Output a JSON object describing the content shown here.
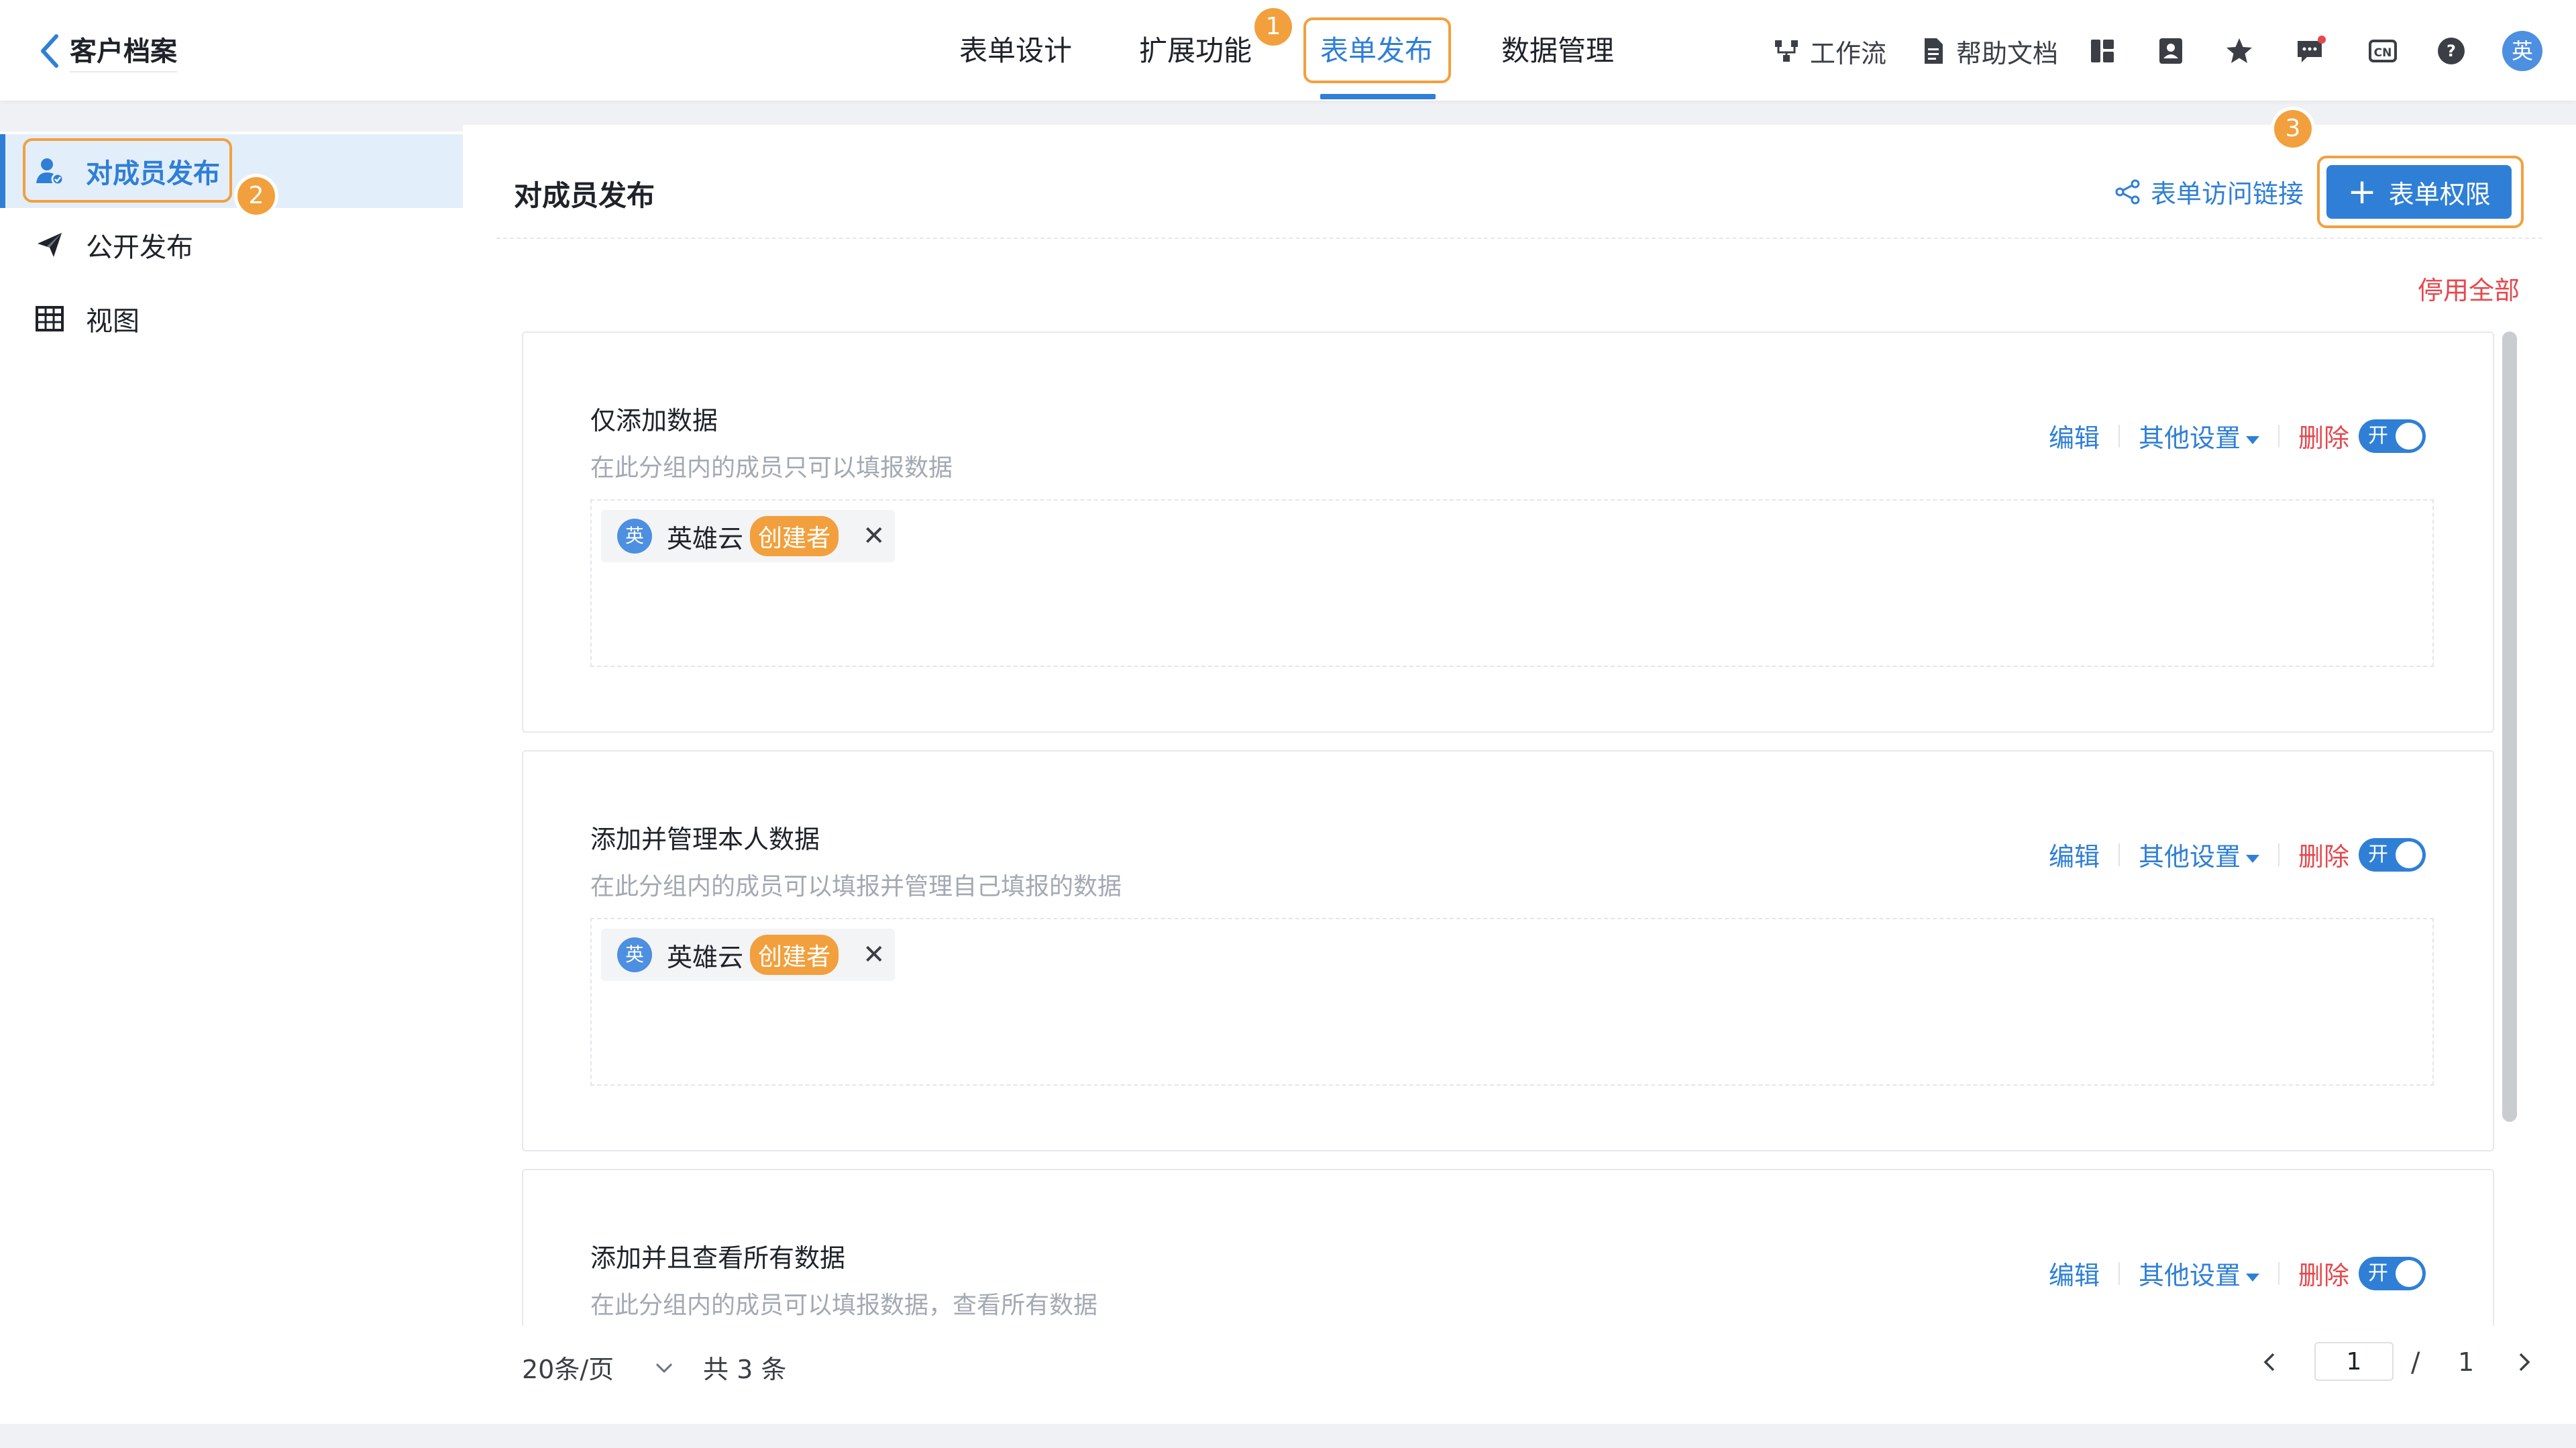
{
  "header": {
    "back_title": "客户档案",
    "tabs": [
      {
        "label": "表单设计"
      },
      {
        "label": "扩展功能"
      },
      {
        "label": "表单发布"
      },
      {
        "label": "数据管理"
      }
    ],
    "tools": {
      "workflow": "工作流",
      "help_docs": "帮助文档"
    },
    "user_avatar": "英",
    "badges": [
      "1",
      "2",
      "3"
    ],
    "colors": {
      "accent": "#2f7fd6",
      "highlight": "#f2a03d",
      "danger": "#e5484d"
    }
  },
  "sidebar": {
    "items": [
      {
        "label": "对成员发布"
      },
      {
        "label": "公开发布"
      },
      {
        "label": "视图"
      }
    ]
  },
  "main": {
    "title": "对成员发布",
    "share_link": "表单访问链接",
    "add_button": "表单权限",
    "disable_all": "停用全部",
    "cards": [
      {
        "title": "仅添加数据",
        "desc": "在此分组内的成员只可以填报数据",
        "edit": "编辑",
        "other_settings": "其他设置",
        "delete": "删除",
        "toggle": "开",
        "member": {
          "avatar": "英",
          "name": "英雄云",
          "role": "创建者"
        }
      },
      {
        "title": "添加并管理本人数据",
        "desc": "在此分组内的成员可以填报并管理自己填报的数据",
        "edit": "编辑",
        "other_settings": "其他设置",
        "delete": "删除",
        "toggle": "开",
        "member": {
          "avatar": "英",
          "name": "英雄云",
          "role": "创建者"
        }
      },
      {
        "title": "添加并且查看所有数据",
        "desc": "在此分组内的成员可以填报数据，查看所有数据",
        "edit": "编辑",
        "other_settings": "其他设置",
        "delete": "删除",
        "toggle": "开"
      }
    ]
  },
  "pagination": {
    "page_size": "20条/页",
    "total": "共 3 条",
    "current_page": "1",
    "separator": "/",
    "total_pages": "1"
  }
}
